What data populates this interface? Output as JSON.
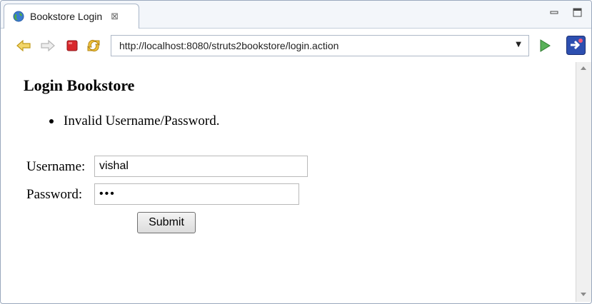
{
  "tab": {
    "title": "Bookstore Login",
    "close_glyph": "⊠",
    "icon": "globe-icon"
  },
  "window": {
    "minimize_icon": "minimize-icon",
    "maximize_icon": "maximize-icon"
  },
  "toolbar": {
    "url": "http://localhost:8080/struts2bookstore/login.action",
    "icons": [
      "back-icon",
      "forward-icon",
      "stop-icon",
      "refresh-icon",
      "dropdown-icon",
      "go-icon",
      "extension-icon"
    ]
  },
  "page": {
    "heading": "Login Bookstore",
    "error_message": "Invalid Username/Password.",
    "username_label": "Username:",
    "username_value": "vishal",
    "password_label": "Password:",
    "password_value": "abc",
    "submit_label": "Submit"
  },
  "colors": {
    "tab_bar": "#f3f6fa",
    "accent_blue": "#2a5ea8",
    "go_green": "#3a9a3a",
    "stop_red": "#d8282c"
  }
}
